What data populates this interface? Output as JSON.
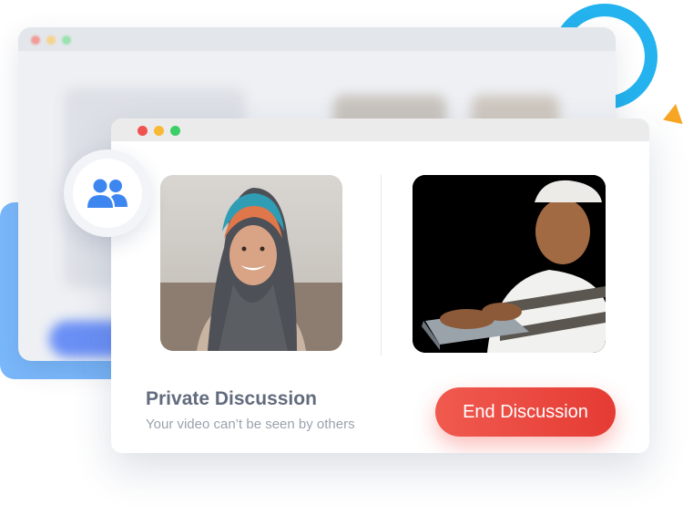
{
  "discussion": {
    "title": "Private Discussion",
    "subtitle": "Your video can’t be seen by others",
    "end_button_label": "End Discussion"
  },
  "participants": [
    {
      "name": "participant-1",
      "icon": "woman-in-hijab-photo"
    },
    {
      "name": "participant-2",
      "icon": "boy-at-laptop-photo"
    }
  ],
  "badge": {
    "icon": "users-icon"
  },
  "colors": {
    "accent_red": "#e8453c",
    "title_gray": "#626b7d",
    "subtitle_gray": "#9ba2ad",
    "ring_blue": "#24b3ee",
    "badge_blue": "#3d86f0",
    "triangle_orange": "#f6a623",
    "window_dot_red": "#ef5350",
    "window_dot_yellow": "#f8b936",
    "window_dot_green": "#3ccf68"
  }
}
